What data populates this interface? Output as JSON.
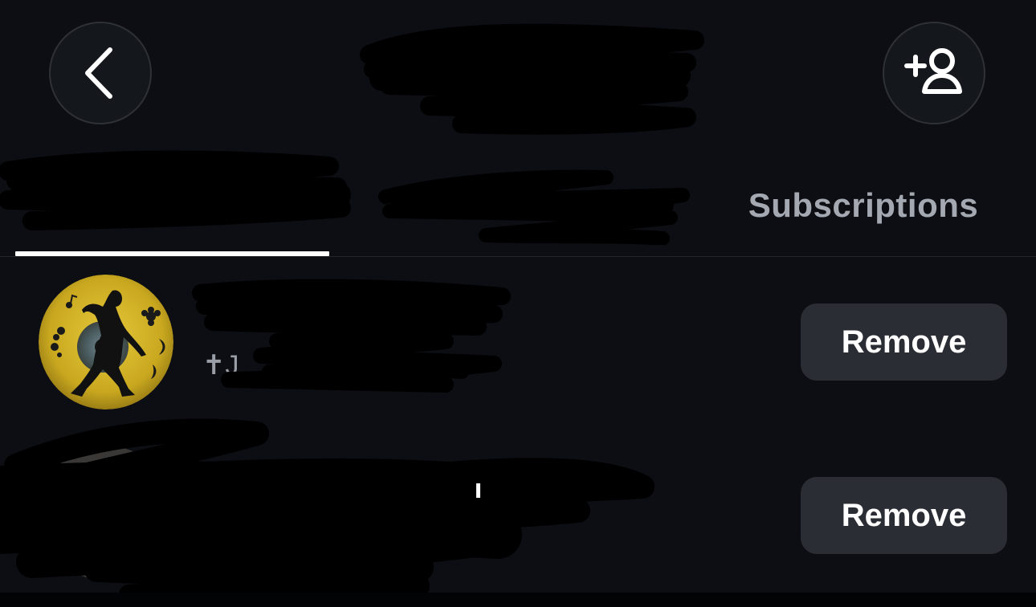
{
  "header": {
    "back_icon": "chevron-left-icon",
    "add_icon": "add-person-icon"
  },
  "tabs": [
    {
      "label": "",
      "active": true
    },
    {
      "label": "",
      "active": false
    },
    {
      "label": "Subscriptions",
      "active": false
    }
  ],
  "rows": [
    {
      "username": "",
      "subtitle": "✝J",
      "remove_label": "Remove"
    },
    {
      "username": "",
      "subtitle": "",
      "remove_label": "Remove"
    }
  ],
  "colors": {
    "background": "#0c0e13",
    "button_bg": "#2a2d33",
    "tab_inactive": "#a4a8b0",
    "indicator": "#ffffff",
    "avatar_yellow": "#c9a81f"
  }
}
